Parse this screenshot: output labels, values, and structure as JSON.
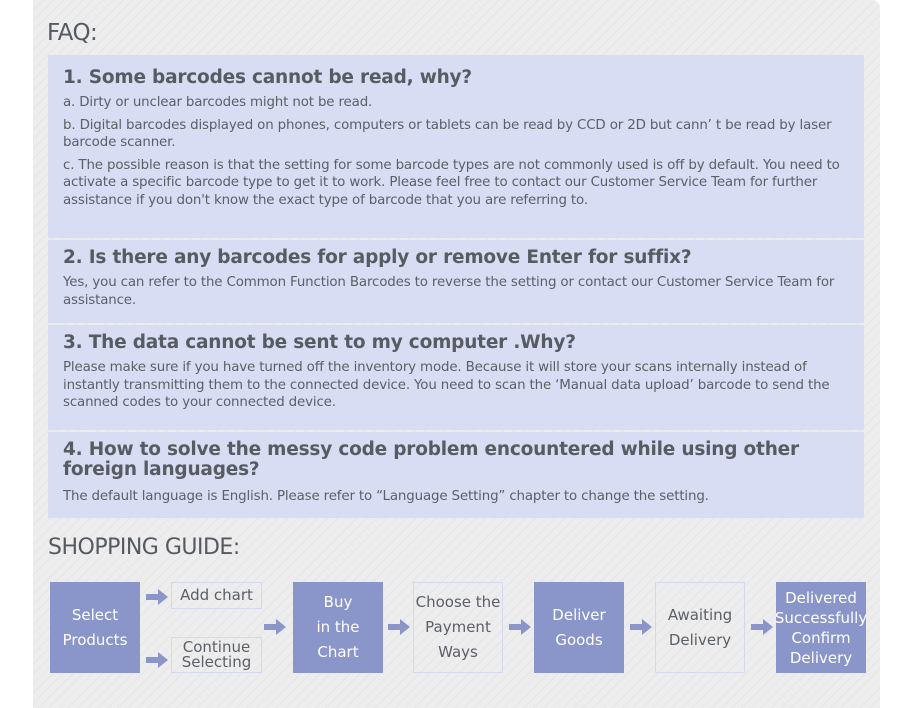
{
  "faq": {
    "title": "FAQ:",
    "items": [
      {
        "question": "1. Some barcodes cannot be read, why?",
        "answers": [
          "a. Dirty or unclear barcodes might not be read.",
          "b. Digital barcodes displayed on phones, computers or tablets can be read by CCD or 2D but cann’ t  be read by laser barcode scanner.",
          "c. The possible reason is that the setting for some barcode types are not commonly used is off by default. You need to activate a specific barcode type to get it to work. Please feel free to contact our Customer Service Team for further assistance if you don't know the exact type of barcode that you are referring to."
        ]
      },
      {
        "question": "2. Is there any barcodes for apply or remove Enter for suffix?",
        "answers": [
          "Yes, you can refer to the Common Function Barcodes to reverse the setting or contact our Customer Service Team for assistance."
        ]
      },
      {
        "question": "3. The data cannot be sent to my computer .Why?",
        "answers": [
          "Please make sure if you have turned off the inventory mode. Because it will store your scans internally instead of instantly transmitting them to the connected device. You need to scan the  ‘Manual data upload’ barcode to send the scanned codes to your connected device."
        ]
      },
      {
        "question": "4. How to solve the messy code problem encountered while using other foreign languages?",
        "answers": [
          "The default language is English. Please refer to  “Language Setting”  chapter to change the setting."
        ]
      }
    ]
  },
  "shopping_guide": {
    "title": "SHOPPING GUIDE:",
    "steps": {
      "select_products": "Select\nProducts",
      "add_chart": "Add chart",
      "continue_selecting": "Continue\nSelecting",
      "buy_in_chart": "Buy\nin the\nChart",
      "choose_payment": "Choose the\nPayment\nWays",
      "deliver_goods": "Deliver\nGoods",
      "awaiting_delivery": "Awaiting\nDelivery",
      "delivered_confirm": "Delivered\nSuccessfully\nConfirm\nDelivery"
    },
    "arrow_icon": "right-arrow-icon",
    "colors": {
      "filled_box": "#8a95c9",
      "faq_bg": "#d9ddf3",
      "arrow": "#8a95c9"
    }
  }
}
